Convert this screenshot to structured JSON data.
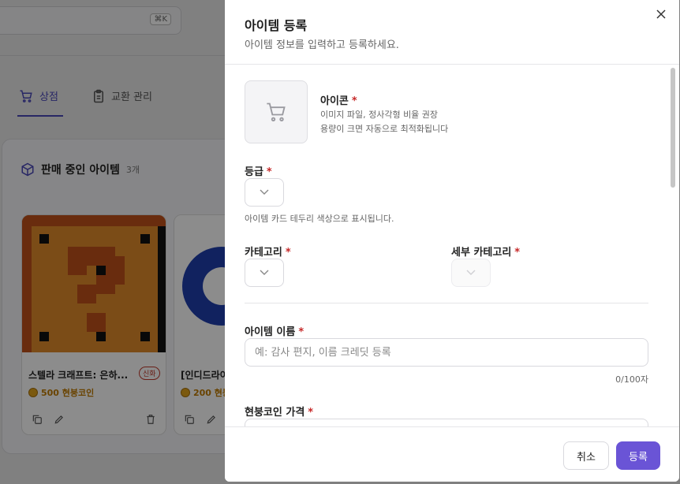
{
  "background": {
    "search_shortcut": "⌘K",
    "tabs": [
      {
        "label": "상점",
        "active": true
      },
      {
        "label": "교환 관리",
        "active": false
      }
    ],
    "panel_title": "판매 중인 아이템",
    "panel_count": "3개",
    "cards": [
      {
        "title": "스텔라 크래프트: 은하...",
        "badge": "신화",
        "price": "500 현붕코인"
      },
      {
        "title": "[인디드라이",
        "price": "200 현붕"
      }
    ]
  },
  "modal": {
    "title": "아이템 등록",
    "subtitle": "아이템 정보를 입력하고 등록하세요.",
    "icon_field": {
      "label": "아이콘",
      "hint1": "이미지 파일, 정사각형 비율 권장",
      "hint2": "용량이 크면 자동으로 최적화됩니다"
    },
    "grade_field": {
      "label": "등급",
      "hint": "아이템 카드 테두리 색상으로 표시됩니다."
    },
    "category_field": {
      "label": "카테고리"
    },
    "subcategory_field": {
      "label": "세부 카테고리"
    },
    "name_field": {
      "label": "아이템 이름",
      "placeholder": "예: 감사 편지, 이름 크레딧 등록",
      "value": "",
      "counter": "0/100자"
    },
    "price_field": {
      "label": "현붕코인 가격"
    },
    "required_mark": "*",
    "buttons": {
      "cancel": "취소",
      "submit": "등록"
    }
  },
  "colors": {
    "accent": "#6a54d6",
    "tab_active": "#4a47b8",
    "required": "#c62828",
    "coin": "#c07a00"
  }
}
